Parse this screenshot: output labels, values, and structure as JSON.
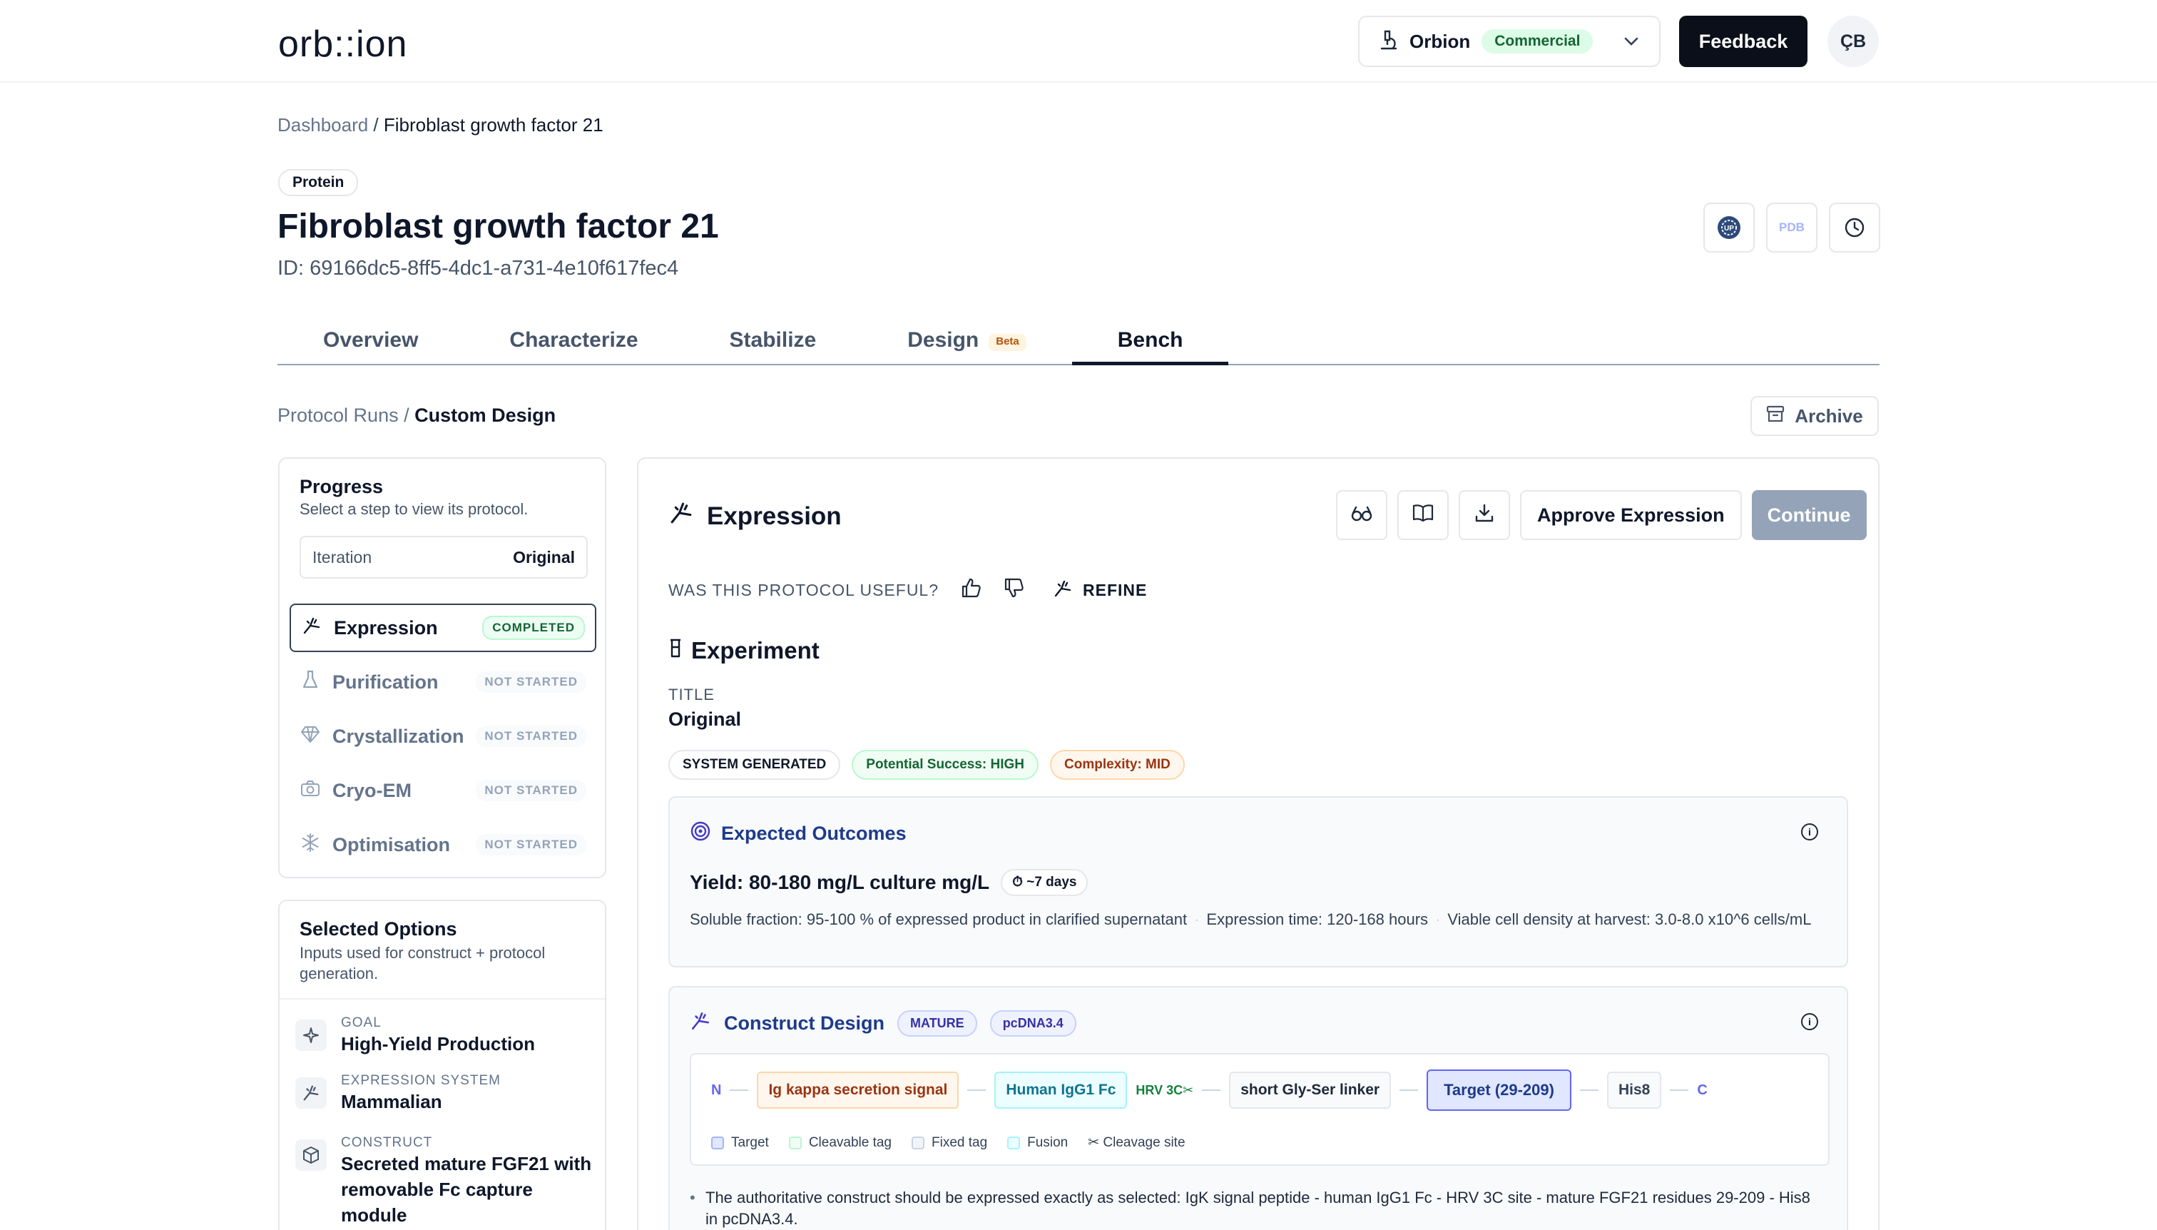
{
  "app": {
    "logo": "orb::ion"
  },
  "topbar": {
    "org_name": "Orbion",
    "org_badge": "Commercial",
    "feedback_label": "Feedback",
    "avatar_initials": "ÇB"
  },
  "breadcrumb": {
    "root": "Dashboard",
    "sep": " / ",
    "current": "Fibroblast growth factor 21"
  },
  "header": {
    "type_badge": "Protein",
    "title": "Fibroblast growth factor 21",
    "id": "ID: 69166dc5-8ff5-4dc1-a731-4e10f617fec4",
    "icons": [
      "uniprot-icon",
      "pdb-icon",
      "history-icon"
    ],
    "pdb_label": "PDB"
  },
  "tabs": [
    {
      "label": "Overview"
    },
    {
      "label": "Characterize"
    },
    {
      "label": "Stabilize"
    },
    {
      "label": "Design",
      "badge": "Beta"
    },
    {
      "label": "Bench",
      "active": true
    }
  ],
  "sub_breadcrumb": {
    "root": "Protocol Runs",
    "sep": " / ",
    "current": "Custom Design"
  },
  "archive_label": "Archive",
  "progress": {
    "title": "Progress",
    "subtitle": "Select a step to view its protocol.",
    "iteration_label": "Iteration",
    "iteration_value": "Original",
    "steps": [
      {
        "name": "Expression",
        "status": "COMPLETED",
        "icon": "expression-icon",
        "active": true
      },
      {
        "name": "Purification",
        "status": "NOT STARTED",
        "icon": "flask-icon"
      },
      {
        "name": "Crystallization",
        "status": "NOT STARTED",
        "icon": "diamond-icon"
      },
      {
        "name": "Cryo-EM",
        "status": "NOT STARTED",
        "icon": "camera-icon"
      },
      {
        "name": "Optimisation",
        "status": "NOT STARTED",
        "icon": "snowflake-icon"
      }
    ]
  },
  "options": {
    "title": "Selected Options",
    "subtitle": "Inputs used for construct + protocol generation.",
    "items": [
      {
        "label": "GOAL",
        "value": "High-Yield Production",
        "icon": "sparkle-icon"
      },
      {
        "label": "EXPRESSION SYSTEM",
        "value": "Mammalian",
        "icon": "expression-icon"
      },
      {
        "label": "CONSTRUCT",
        "value": "Secreted mature FGF21 with removable Fc capture module",
        "icon": "cube-icon"
      }
    ]
  },
  "panel": {
    "title": "Expression",
    "approve_label": "Approve Expression",
    "continue_label": "Continue",
    "useful_question": "WAS THIS PROTOCOL USEFUL?",
    "refine_label": "REFINE",
    "experiment_heading": "Experiment",
    "title_label": "TITLE",
    "title_value": "Original",
    "chips": {
      "system": "SYSTEM GENERATED",
      "success": "Potential Success: HIGH",
      "complexity": "Complexity: MID"
    }
  },
  "outcomes": {
    "heading": "Expected Outcomes",
    "yield": "Yield: 80-180 mg/L culture mg/L",
    "duration": "~7 days",
    "metric_1": "Soluble fraction: 95-100 % of expressed product in clarified supernatant",
    "metric_2": "Expression time: 120-168 hours",
    "metric_3": "Viable cell density at harvest: 3.0-8.0 x10^6 cells/mL"
  },
  "construct": {
    "heading": "Construct Design",
    "chip_1": "MATURE",
    "chip_2": "pcDNA3.4",
    "n_term": "N",
    "c_term": "C",
    "segments": {
      "signal": "Ig kappa secretion signal",
      "fc": "Human IgG1 Fc",
      "cut": "HRV 3C✂",
      "linker": "short Gly-Ser linker",
      "target": "Target (29-209)",
      "his": "His8"
    },
    "legend": {
      "target": "Target",
      "cleavable": "Cleavable tag",
      "fixed": "Fixed tag",
      "fusion": "Fusion",
      "cleavage": "✂ Cleavage site"
    },
    "note": "The authoritative construct should be expressed exactly as selected: IgK signal peptide - human IgG1 Fc - HRV 3C site - mature FGF21 residues 29-209 - His8 in pcDNA3.4."
  }
}
